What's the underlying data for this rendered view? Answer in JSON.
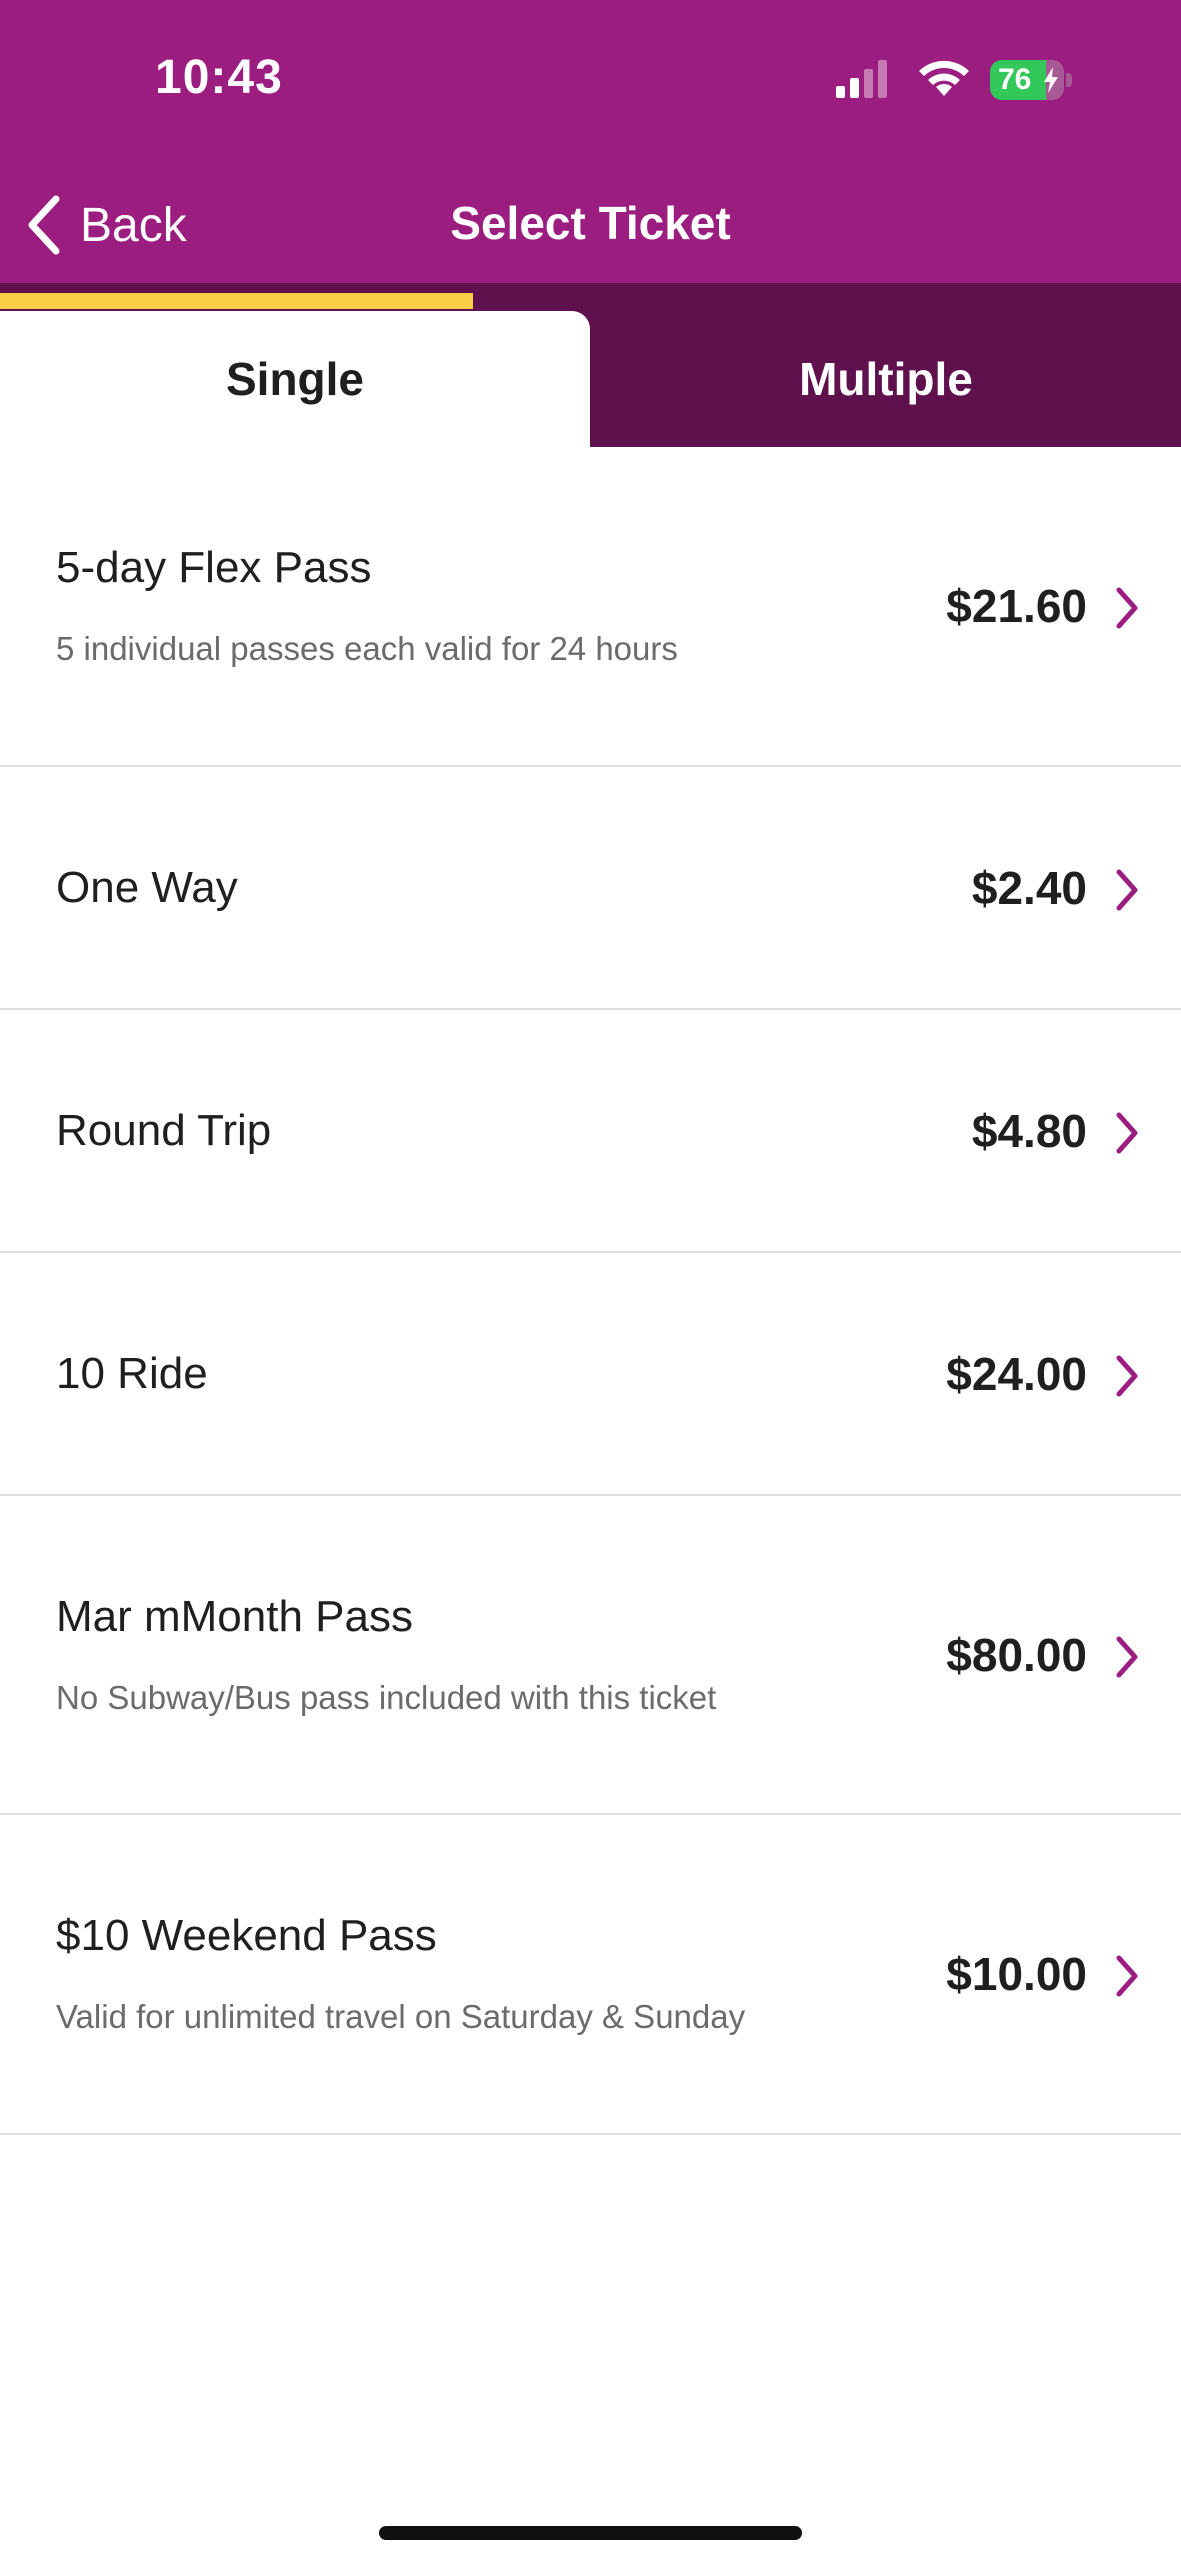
{
  "status_bar": {
    "time": "10:43",
    "battery_text": "76",
    "battery_level": 0.76,
    "icons": [
      "signal-icon",
      "wifi-icon",
      "battery-icon",
      "bolt-icon"
    ]
  },
  "nav": {
    "back_label": "Back",
    "title": "Select Ticket"
  },
  "tabs": [
    {
      "label": "Single",
      "active": true
    },
    {
      "label": "Multiple",
      "active": false
    }
  ],
  "tickets": [
    {
      "title": "5-day Flex Pass",
      "subtitle": "5 individual passes each valid for 24 hours",
      "price": "$21.60"
    },
    {
      "title": "One Way",
      "subtitle": "",
      "price": "$2.40"
    },
    {
      "title": "Round Trip",
      "subtitle": "",
      "price": "$4.80"
    },
    {
      "title": "10 Ride",
      "subtitle": "",
      "price": "$24.00"
    },
    {
      "title": "Mar mMonth Pass",
      "subtitle": "No Subway/Bus pass included with this ticket",
      "price": "$80.00"
    },
    {
      "title": "$10 Weekend Pass",
      "subtitle": "Valid for unlimited travel on Saturday & Sunday",
      "price": "$10.00"
    }
  ],
  "colors": {
    "header": "#9c1d80",
    "tab_bar": "#5e114d",
    "tab_indicator": "#f7cf46",
    "chevron": "#9c1d80",
    "battery_fill": "#34c759"
  }
}
